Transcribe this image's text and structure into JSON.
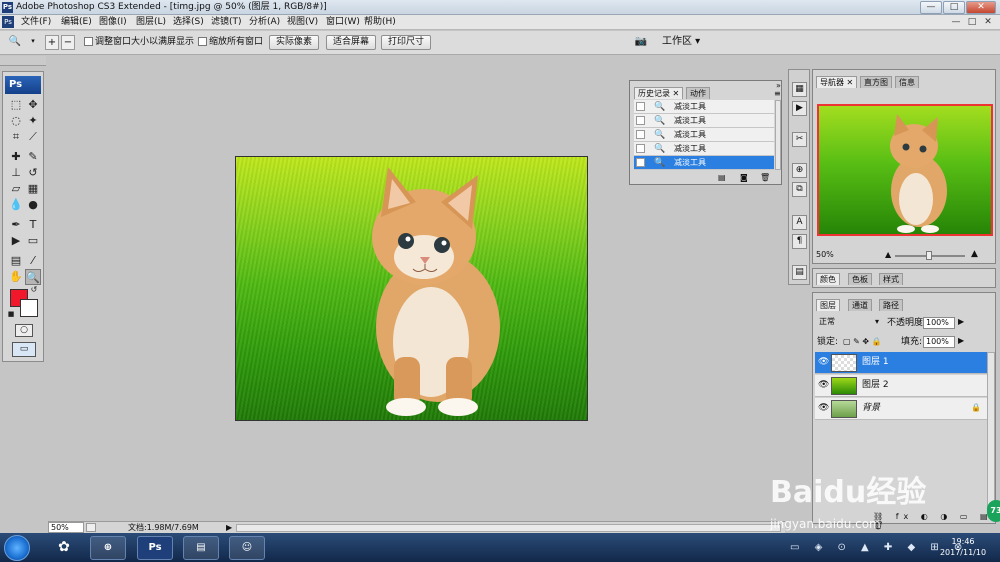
{
  "window": {
    "app_icon": "Ps",
    "title": "Adobe Photoshop CS3 Extended - [timg.jpg @ 50% (图层 1, RGB/8#)]",
    "controls": [
      "—",
      "□",
      "✕"
    ]
  },
  "menubar": {
    "items": [
      "文件(F)",
      "编辑(E)",
      "图像(I)",
      "图层(L)",
      "选择(S)",
      "滤镜(T)",
      "分析(A)",
      "视图(V)",
      "窗口(W)",
      "帮助(H)"
    ],
    "doc_controls": [
      "—",
      "□",
      "✕"
    ]
  },
  "options": {
    "check1_label": "调整窗口大小以满屏显示",
    "check2_label": "缩放所有窗口",
    "btn_actual": "实际像素",
    "btn_fit": "适合屏幕",
    "btn_print": "打印尺寸",
    "workspace": "工作区 ▾"
  },
  "toolbox": {
    "logo": "Ps",
    "fg_color": "#f0182a",
    "bg_color": "#ffffff"
  },
  "status": {
    "zoom": "50%",
    "doc_info": "文档:1.98M/7.69M"
  },
  "history": {
    "tabs": [
      "历史记录",
      "动作"
    ],
    "rows": [
      "减淡工具",
      "减淡工具",
      "减淡工具",
      "减淡工具",
      "减淡工具"
    ],
    "selected_index": 4
  },
  "navigator": {
    "tabs": [
      "导航器",
      "直方图",
      "信息"
    ],
    "zoom": "50%"
  },
  "color_panel": {
    "tabs": [
      "颜色",
      "色板",
      "样式"
    ]
  },
  "layers": {
    "tabs": [
      "图层",
      "通道",
      "路径"
    ],
    "blend_mode": "正常",
    "opacity_label": "不透明度:",
    "opacity_value": "100%",
    "lock_label": "锁定:",
    "fill_label": "填充:",
    "fill_value": "100%",
    "rows": [
      "图层 1",
      "图层 2",
      "背景"
    ],
    "selected_index": 0
  },
  "taskbar": {
    "ps_label": "Ps",
    "time": "19:46",
    "date": "2017/11/10"
  },
  "watermark": {
    "text": "Baidu经验",
    "url": "jingyan.baidu.com",
    "badge": "73"
  }
}
